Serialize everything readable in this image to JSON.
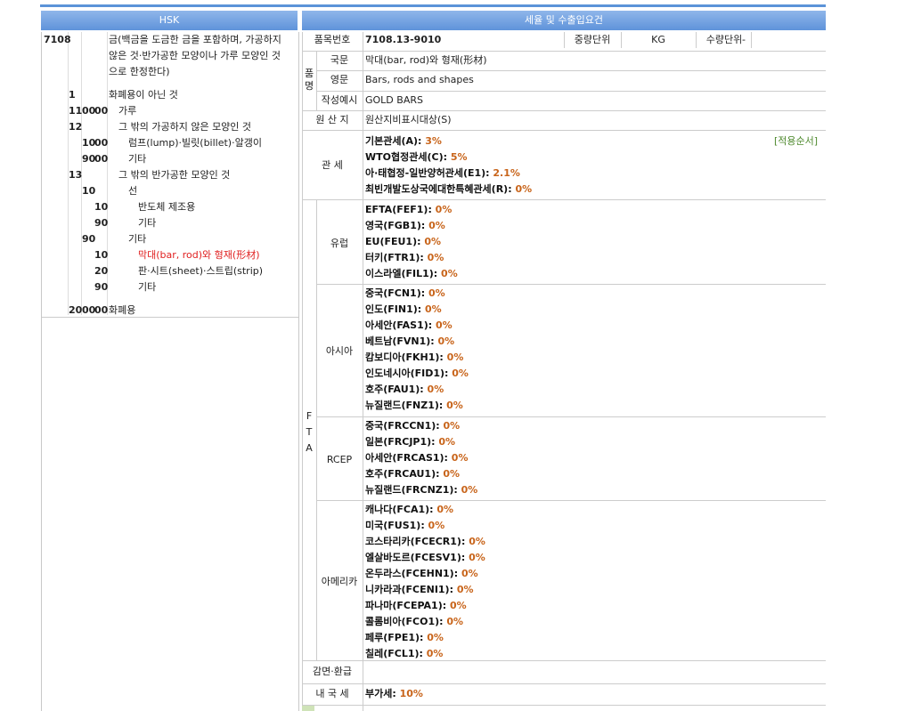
{
  "header": {
    "hsk": "HSK",
    "tax": "세율 및 수출입요건"
  },
  "hsk_rows": [
    {
      "a": "7108",
      "b": "",
      "c": "",
      "d": "",
      "e": "",
      "desc": "금(백금을 도금한 금을 포함하며, 가공하지",
      "red": false,
      "indent": 0
    },
    {
      "a": "",
      "b": "",
      "c": "",
      "d": "",
      "e": "",
      "desc": "않은 것·반가공한 모양이나 가루 모양인 것",
      "red": false,
      "indent": 0
    },
    {
      "a": "",
      "b": "",
      "c": "",
      "d": "",
      "e": "",
      "desc": "으로 한정한다)",
      "red": false,
      "indent": 0
    },
    {
      "a": "",
      "b": "1",
      "c": "",
      "d": "",
      "e": "",
      "desc": "화폐용이 아닌 것",
      "red": false,
      "indent": 0
    },
    {
      "a": "",
      "b": "11",
      "c": "00",
      "d": "00",
      "e": "",
      "desc": "가루",
      "red": false,
      "indent": 1
    },
    {
      "a": "",
      "b": "12",
      "c": "",
      "d": "",
      "e": "",
      "desc": "그 밖의 가공하지 않은 모양인 것",
      "red": false,
      "indent": 1
    },
    {
      "a": "",
      "b": "",
      "c": "10",
      "d": "00",
      "e": "",
      "desc": "럼프(lump)·빌릿(billet)·알갱이",
      "red": false,
      "indent": 2
    },
    {
      "a": "",
      "b": "",
      "c": "90",
      "d": "00",
      "e": "",
      "desc": "기타",
      "red": false,
      "indent": 2
    },
    {
      "a": "",
      "b": "13",
      "c": "",
      "d": "",
      "e": "",
      "desc": "그 밖의 반가공한 모양인 것",
      "red": false,
      "indent": 1
    },
    {
      "a": "",
      "b": "",
      "c": "10",
      "d": "",
      "e": "",
      "desc": "선",
      "red": false,
      "indent": 2
    },
    {
      "a": "",
      "b": "",
      "c": "",
      "d": "10",
      "e": "",
      "desc": "반도체 제조용",
      "red": false,
      "indent": 3
    },
    {
      "a": "",
      "b": "",
      "c": "",
      "d": "90",
      "e": "",
      "desc": "기타",
      "red": false,
      "indent": 3
    },
    {
      "a": "",
      "b": "",
      "c": "90",
      "d": "",
      "e": "",
      "desc": "기타",
      "red": false,
      "indent": 2
    },
    {
      "a": "",
      "b": "",
      "c": "",
      "d": "10",
      "e": "",
      "desc": "막대(bar, rod)와 형재(形材)",
      "red": true,
      "indent": 3
    },
    {
      "a": "",
      "b": "",
      "c": "",
      "d": "20",
      "e": "",
      "desc": "판·시트(sheet)·스트립(strip)",
      "red": false,
      "indent": 3
    },
    {
      "a": "",
      "b": "",
      "c": "",
      "d": "90",
      "e": "",
      "desc": "기타",
      "red": false,
      "indent": 3
    },
    {
      "a": "",
      "b": "20",
      "c": "00",
      "d": "00",
      "e": "",
      "desc": "화폐용",
      "red": false,
      "indent": 0
    }
  ],
  "info": {
    "item_no_label": "품목번호",
    "item_no": "7108.13-9010",
    "weight_unit_label": "중량단위",
    "weight_unit": "KG",
    "qty_unit_label": "수량단위",
    "qty_unit": "-",
    "name_group": "품명",
    "kr_label": "국문",
    "kr": "막대(bar, rod)와 형재(形材)",
    "en_label": "영문",
    "en": "Bars, rods and shapes",
    "ex_label": "작성예시",
    "ex": "GOLD BARS",
    "origin_label": "원 산 지",
    "origin": "원산지비표시대상(S)"
  },
  "tariff": {
    "label": "관 세",
    "order_link": "[적용순서]",
    "rates": [
      {
        "name": "기본관세(A): ",
        "val": "3%"
      },
      {
        "name": "WTO협정관세(C): ",
        "val": "5%"
      },
      {
        "name": "아·태협정-일반양허관세(E1): ",
        "val": "2.1%"
      },
      {
        "name": "최빈개발도상국에대한특혜관세(R): ",
        "val": "0%"
      }
    ]
  },
  "fta": {
    "label": "F T A",
    "groups": [
      {
        "name": "유럽",
        "rates": [
          {
            "name": "EFTA(FEF1): ",
            "val": "0%"
          },
          {
            "name": "영국(FGB1): ",
            "val": "0%"
          },
          {
            "name": "EU(FEU1): ",
            "val": "0%"
          },
          {
            "name": "터키(FTR1): ",
            "val": "0%"
          },
          {
            "name": "이스라엘(FIL1): ",
            "val": "0%"
          }
        ]
      },
      {
        "name": "아시아",
        "rates": [
          {
            "name": "중국(FCN1): ",
            "val": "0%"
          },
          {
            "name": "인도(FIN1): ",
            "val": "0%"
          },
          {
            "name": "아세안(FAS1): ",
            "val": "0%"
          },
          {
            "name": "베트남(FVN1): ",
            "val": "0%"
          },
          {
            "name": "캄보디아(FKH1): ",
            "val": "0%"
          },
          {
            "name": "인도네시아(FID1): ",
            "val": "0%"
          },
          {
            "name": "호주(FAU1): ",
            "val": "0%"
          },
          {
            "name": "뉴질랜드(FNZ1): ",
            "val": "0%"
          }
        ]
      },
      {
        "name": "RCEP",
        "rates": [
          {
            "name": "중국(FRCCN1): ",
            "val": "0%"
          },
          {
            "name": "일본(FRCJP1): ",
            "val": "0%"
          },
          {
            "name": "아세안(FRCAS1): ",
            "val": "0%"
          },
          {
            "name": "호주(FRCAU1): ",
            "val": "0%"
          },
          {
            "name": "뉴질랜드(FRCNZ1): ",
            "val": "0%"
          }
        ]
      },
      {
        "name": "아메리카",
        "rates": [
          {
            "name": "캐나다(FCA1): ",
            "val": "0%"
          },
          {
            "name": "미국(FUS1): ",
            "val": "0%"
          },
          {
            "name": "코스타리카(FCECR1): ",
            "val": "0%"
          },
          {
            "name": "엘살바도르(FCESV1): ",
            "val": "0%"
          },
          {
            "name": "온두라스(FCEHN1): ",
            "val": "0%"
          },
          {
            "name": "니카라과(FCENI1): ",
            "val": "0%"
          },
          {
            "name": "파나마(FCEPA1): ",
            "val": "0%"
          },
          {
            "name": "콜롬비아(FCO1): ",
            "val": "0%"
          },
          {
            "name": "페루(FPE1): ",
            "val": "0%"
          },
          {
            "name": "칠레(FCL1): ",
            "val": "0%"
          }
        ]
      }
    ]
  },
  "reduction": {
    "label": "감면·환급",
    "value": ""
  },
  "domestic": {
    "label": "내 국 세",
    "name": "부가세: ",
    "val": "10%"
  }
}
